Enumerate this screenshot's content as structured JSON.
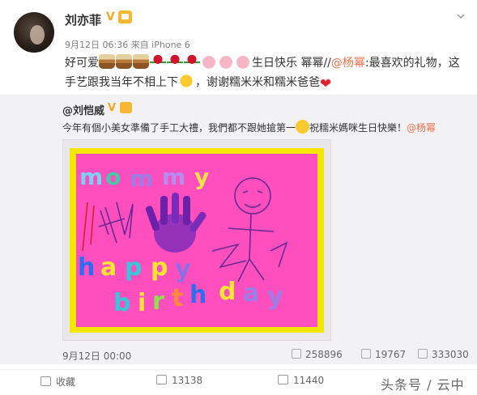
{
  "post": {
    "author": "刘亦菲",
    "verified_badge": "V",
    "meta": "9月12日 06:36 来自 iPhone 6",
    "text_line1_a": "好可爱",
    "text_line1_b": "生日快乐 幂幂//",
    "mention1": "@杨幂",
    "text_line1_c": ":最喜欢的礼物，这",
    "text_line2_a": "手艺跟我当年不相上下",
    "text_line2_b": "，谢谢糯米米和糯米爸爸",
    "icons": [
      "chevron-down-icon",
      "cake-emoji",
      "rose-emoji",
      "pig-emoji",
      "sweat-emoji",
      "heart-emoji"
    ]
  },
  "repost": {
    "author": "@刘恺威",
    "verified_badge": "V",
    "text_a": "今年有個小美女準備了手工大禮，我們都不跟她搶第一",
    "text_b": "祝糯米媽咪生日快樂！",
    "mention": "@杨幂",
    "photo": {
      "word1": [
        "m",
        "o",
        "m",
        "m",
        "y"
      ],
      "word2": [
        "h",
        "a",
        "p",
        "p",
        "y"
      ],
      "word3": [
        "b",
        "i",
        "r",
        "t",
        "h",
        "d",
        "a",
        "y"
      ]
    },
    "date": "9月12日 00:00",
    "reposts": "258896",
    "comments": "19767",
    "likes": "333030"
  },
  "actions": {
    "favorite": "收藏",
    "share": "13138",
    "comment": "11440"
  },
  "watermark": "头条号 / 云中会",
  "colors": {
    "accent": "#eb7350",
    "badge": "#f5a623"
  }
}
